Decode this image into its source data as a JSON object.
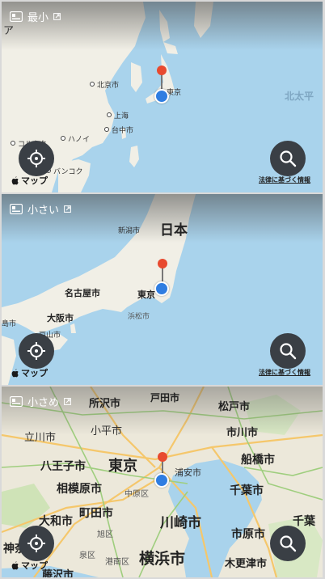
{
  "widgets": [
    {
      "size_label": "最小",
      "labels": {
        "a": "ア",
        "beijing": "北京市",
        "tokyo": "東京",
        "shanghai": "上海",
        "taipei": "台中市",
        "hanoi": "ハノイ",
        "kolkata": "コルカタ",
        "bangkok": "バンコク",
        "pacific": "北太平"
      }
    },
    {
      "size_label": "小さい",
      "labels": {
        "niigata": "新潟市",
        "japan": "日本",
        "nagoya": "名古屋市",
        "tokyo": "東京",
        "osaka": "大阪市",
        "hamamatsu": "浜松市",
        "hiroshima": "島市",
        "kobe": "戸山市"
      }
    },
    {
      "size_label": "小さめ",
      "labels": {
        "tokorozawa": "所沢市",
        "toda": "戸田市",
        "matsudo": "松戸市",
        "tachikawa": "立川市",
        "kodaira": "小平市",
        "ichikawa": "市川市",
        "hachioji": "八王子市",
        "tokyo": "東京",
        "urayasu": "浦安市",
        "funabashi": "船橋市",
        "sagamihara": "相模原市",
        "nakahara": "中原区",
        "chiba": "千葉市",
        "yamato": "大和市",
        "machida": "町田市",
        "kawasaki": "川崎市",
        "chiba2": "千葉",
        "asahi": "旭区",
        "ichihara": "市原市",
        "kanagawa": "神奈",
        "izumi": "泉区",
        "minato": "港南区",
        "yokohama": "横浜市",
        "kisarazu": "木更津市",
        "fujisawa": "藤沢市"
      }
    }
  ],
  "brand_label": "マップ",
  "legal_label": "法律に基づく情報",
  "icons": {
    "widget": "widget-icon",
    "external": "external-link-icon",
    "location": "location-crosshair-icon",
    "search": "magnifier-icon",
    "pin": "red-map-pin-icon",
    "user": "user-location-dot-icon",
    "apple": "apple-logo-icon"
  },
  "colors": {
    "sea": "#a9d3ec",
    "land": "#f1efe6",
    "pin": "#e84a2f",
    "user": "#2f7de1",
    "button": "#3a3f45"
  }
}
